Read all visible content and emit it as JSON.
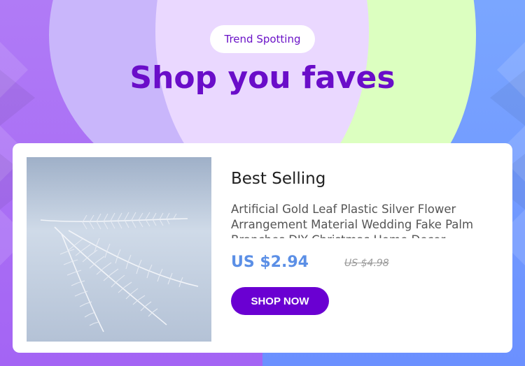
{
  "banner": {
    "tag_label": "Trend Spotting",
    "headline": "Shop you faves"
  },
  "product": {
    "section_title": "Best Selling",
    "description": "Artificial Gold Leaf Plastic Silver Flower Arrangement Material Wedding Fake Palm Branches DIY Christmas Home Decor",
    "price": "US $2.94",
    "original_price": "US $4.98",
    "cta_label": "SHOP NOW",
    "image_icon": "silver-fern-leaf"
  },
  "colors": {
    "headline": "#6a0dc9",
    "price": "#5b8fe6",
    "button": "#6a00d2",
    "bg_left": "#a464f4",
    "bg_right": "#6b90ff"
  }
}
